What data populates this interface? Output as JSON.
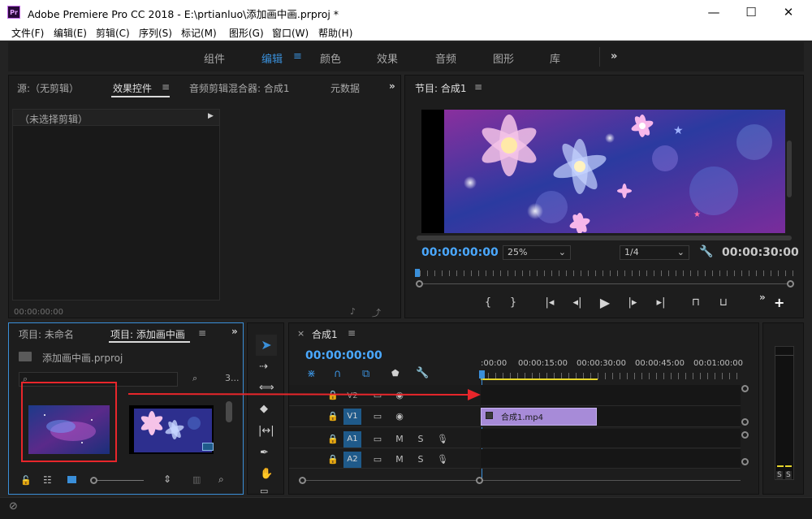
{
  "window": {
    "title": "Adobe Premiere Pro CC 2018 - E:\\prtianluo\\添加画中画.prproj *",
    "app_icon": "Pr"
  },
  "menu": [
    "文件(F)",
    "编辑(E)",
    "剪辑(C)",
    "序列(S)",
    "标记(M)",
    "图形(G)",
    "窗口(W)",
    "帮助(H)"
  ],
  "workspaces": {
    "items": [
      "组件",
      "编辑",
      "颜色",
      "效果",
      "音频",
      "图形",
      "库"
    ],
    "active": "编辑",
    "more": "»"
  },
  "source_panel": {
    "tabs": [
      "源:（无剪辑）",
      "效果控件",
      "音频剪辑混合器: 合成1",
      "元数据"
    ],
    "active_tab": "效果控件",
    "no_clip_label": "（未选择剪辑）",
    "timecode": "00:00:00:00"
  },
  "program_monitor": {
    "title": "节目: 合成1",
    "timecode_current": "00:00:00:00",
    "zoom": "25%",
    "resolution": "1/4",
    "timecode_duration": "00:00:30:00"
  },
  "project_panel": {
    "tabs": [
      "项目: 未命名",
      "项目: 添加画中画"
    ],
    "active_tab": "项目: 添加画中画",
    "file_name": "添加画中画.prproj",
    "item_count": "3..."
  },
  "timeline": {
    "sequence_name": "合成1",
    "timecode": "00:00:00:00",
    "ruler": [
      ":00:00",
      "00:00:15:00",
      "00:00:30:00",
      "00:00:45:00",
      "00:01:00:00"
    ],
    "video_tracks": [
      "V2",
      "V1"
    ],
    "audio_tracks": [
      "A1",
      "A2"
    ],
    "audio_btns": [
      "M",
      "S"
    ],
    "clip_name": "合成1.mp4",
    "meter_labels": [
      "S",
      "S"
    ]
  },
  "colors": {
    "accent": "#3a8fd9",
    "clip": "#a78bd8",
    "annotation": "#e8262b",
    "track_blue": "#1f5a8a"
  }
}
